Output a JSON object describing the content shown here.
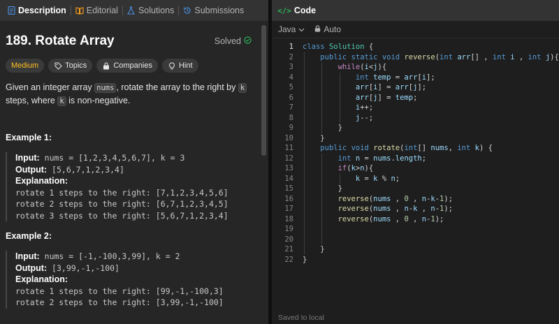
{
  "tabs": [
    {
      "label": "Description",
      "icon": "description-icon",
      "active": true
    },
    {
      "label": "Editorial",
      "icon": "book-icon",
      "active": false
    },
    {
      "label": "Solutions",
      "icon": "flask-icon",
      "active": false
    },
    {
      "label": "Submissions",
      "icon": "history-icon",
      "active": false
    }
  ],
  "problem": {
    "title": "189. Rotate Array",
    "status": "Solved",
    "difficulty": "Medium",
    "tags": [
      "Topics",
      "Companies",
      "Hint"
    ],
    "description_pre": "Given an integer array ",
    "description_code1": "nums",
    "description_mid": ", rotate the array to the right by ",
    "description_code2": "k",
    "description_mid2": " steps, where ",
    "description_code3": "k",
    "description_post": " is non-negative."
  },
  "examples": [
    {
      "title": "Example 1:",
      "input_label": "Input:",
      "input": " nums = [1,2,3,4,5,6,7], k = 3",
      "output_label": "Output:",
      "output": " [5,6,7,1,2,3,4]",
      "explanation_label": "Explanation:",
      "explanation": [
        "rotate 1 steps to the right: [7,1,2,3,4,5,6]",
        "rotate 2 steps to the right: [6,7,1,2,3,4,5]",
        "rotate 3 steps to the right: [5,6,7,1,2,3,4]"
      ]
    },
    {
      "title": "Example 2:",
      "input_label": "Input:",
      "input": " nums = [-1,-100,3,99], k = 2",
      "output_label": "Output:",
      "output": " [3,99,-1,-100]",
      "explanation_label": "Explanation:",
      "explanation": [
        "rotate 1 steps to the right: [99,-1,-100,3]",
        "rotate 2 steps to the right: [3,99,-1,-100]"
      ]
    }
  ],
  "code_panel": {
    "title": "Code",
    "language": "Java",
    "mode": "Auto",
    "status": "Saved to local",
    "current_line": 1,
    "lines": [
      [
        [
          "kw",
          "class"
        ],
        [
          "op",
          " "
        ],
        [
          "ty",
          "Solution"
        ],
        [
          "op",
          " {"
        ]
      ],
      [
        [
          "op",
          "    "
        ],
        [
          "kw",
          "public"
        ],
        [
          "op",
          " "
        ],
        [
          "kw",
          "static"
        ],
        [
          "op",
          " "
        ],
        [
          "kw",
          "void"
        ],
        [
          "op",
          " "
        ],
        [
          "fn",
          "reverse"
        ],
        [
          "op",
          "("
        ],
        [
          "kw",
          "int"
        ],
        [
          "op",
          " "
        ],
        [
          "vr",
          "arr"
        ],
        [
          "op",
          "[] , "
        ],
        [
          "kw",
          "int"
        ],
        [
          "op",
          " "
        ],
        [
          "vr",
          "i"
        ],
        [
          "op",
          " , "
        ],
        [
          "kw",
          "int"
        ],
        [
          "op",
          " "
        ],
        [
          "vr",
          "j"
        ],
        [
          "op",
          "){"
        ]
      ],
      [
        [
          "op",
          "        "
        ],
        [
          "ctl",
          "while"
        ],
        [
          "op",
          "("
        ],
        [
          "vr",
          "i"
        ],
        [
          "op",
          "<"
        ],
        [
          "vr",
          "j"
        ],
        [
          "op",
          "){"
        ]
      ],
      [
        [
          "op",
          "            "
        ],
        [
          "kw",
          "int"
        ],
        [
          "op",
          " "
        ],
        [
          "vr",
          "temp"
        ],
        [
          "op",
          " = "
        ],
        [
          "vr",
          "arr"
        ],
        [
          "op",
          "["
        ],
        [
          "vr",
          "i"
        ],
        [
          "op",
          "];"
        ]
      ],
      [
        [
          "op",
          "            "
        ],
        [
          "vr",
          "arr"
        ],
        [
          "op",
          "["
        ],
        [
          "vr",
          "i"
        ],
        [
          "op",
          "] = "
        ],
        [
          "vr",
          "arr"
        ],
        [
          "op",
          "["
        ],
        [
          "vr",
          "j"
        ],
        [
          "op",
          "];"
        ]
      ],
      [
        [
          "op",
          "            "
        ],
        [
          "vr",
          "arr"
        ],
        [
          "op",
          "["
        ],
        [
          "vr",
          "j"
        ],
        [
          "op",
          "] = "
        ],
        [
          "vr",
          "temp"
        ],
        [
          "op",
          ";"
        ]
      ],
      [
        [
          "op",
          "            "
        ],
        [
          "vr",
          "i"
        ],
        [
          "op",
          "++;"
        ]
      ],
      [
        [
          "op",
          "            "
        ],
        [
          "vr",
          "j"
        ],
        [
          "op",
          "--;"
        ]
      ],
      [
        [
          "op",
          "        }"
        ]
      ],
      [
        [
          "op",
          "    }"
        ]
      ],
      [
        [
          "op",
          "    "
        ],
        [
          "kw",
          "public"
        ],
        [
          "op",
          " "
        ],
        [
          "kw",
          "void"
        ],
        [
          "op",
          " "
        ],
        [
          "fn",
          "rotate"
        ],
        [
          "op",
          "("
        ],
        [
          "kw",
          "int"
        ],
        [
          "op",
          "[] "
        ],
        [
          "vr",
          "nums"
        ],
        [
          "op",
          ", "
        ],
        [
          "kw",
          "int"
        ],
        [
          "op",
          " "
        ],
        [
          "vr",
          "k"
        ],
        [
          "op",
          ") {"
        ]
      ],
      [
        [
          "op",
          "        "
        ],
        [
          "kw",
          "int"
        ],
        [
          "op",
          " "
        ],
        [
          "vr",
          "n"
        ],
        [
          "op",
          " = "
        ],
        [
          "vr",
          "nums"
        ],
        [
          "op",
          "."
        ],
        [
          "vr",
          "length"
        ],
        [
          "op",
          ";"
        ]
      ],
      [
        [
          "op",
          "        "
        ],
        [
          "ctl",
          "if"
        ],
        [
          "op",
          "("
        ],
        [
          "vr",
          "k"
        ],
        [
          "op",
          ">"
        ],
        [
          "vr",
          "n"
        ],
        [
          "op",
          "){"
        ]
      ],
      [
        [
          "op",
          "            "
        ],
        [
          "vr",
          "k"
        ],
        [
          "op",
          " = "
        ],
        [
          "vr",
          "k"
        ],
        [
          "op",
          " % "
        ],
        [
          "vr",
          "n"
        ],
        [
          "op",
          ";"
        ]
      ],
      [
        [
          "op",
          "        }"
        ]
      ],
      [
        [
          "op",
          "        "
        ],
        [
          "fn",
          "reverse"
        ],
        [
          "op",
          "("
        ],
        [
          "vr",
          "nums"
        ],
        [
          "op",
          " , "
        ],
        [
          "nm",
          "0"
        ],
        [
          "op",
          " , "
        ],
        [
          "vr",
          "n"
        ],
        [
          "op",
          "-"
        ],
        [
          "vr",
          "k"
        ],
        [
          "op",
          "-"
        ],
        [
          "nm",
          "1"
        ],
        [
          "op",
          ");"
        ]
      ],
      [
        [
          "op",
          "        "
        ],
        [
          "fn",
          "reverse"
        ],
        [
          "op",
          "("
        ],
        [
          "vr",
          "nums"
        ],
        [
          "op",
          " , "
        ],
        [
          "vr",
          "n"
        ],
        [
          "op",
          "-"
        ],
        [
          "vr",
          "k"
        ],
        [
          "op",
          " , "
        ],
        [
          "vr",
          "n"
        ],
        [
          "op",
          "-"
        ],
        [
          "nm",
          "1"
        ],
        [
          "op",
          ");"
        ]
      ],
      [
        [
          "op",
          "        "
        ],
        [
          "fn",
          "reverse"
        ],
        [
          "op",
          "("
        ],
        [
          "vr",
          "nums"
        ],
        [
          "op",
          " , "
        ],
        [
          "nm",
          "0"
        ],
        [
          "op",
          " , "
        ],
        [
          "vr",
          "n"
        ],
        [
          "op",
          "-"
        ],
        [
          "nm",
          "1"
        ],
        [
          "op",
          ");"
        ]
      ],
      [
        [
          "op",
          ""
        ]
      ],
      [
        [
          "op",
          ""
        ]
      ],
      [
        [
          "op",
          "    }"
        ]
      ],
      [
        [
          "op",
          "}"
        ]
      ]
    ]
  }
}
